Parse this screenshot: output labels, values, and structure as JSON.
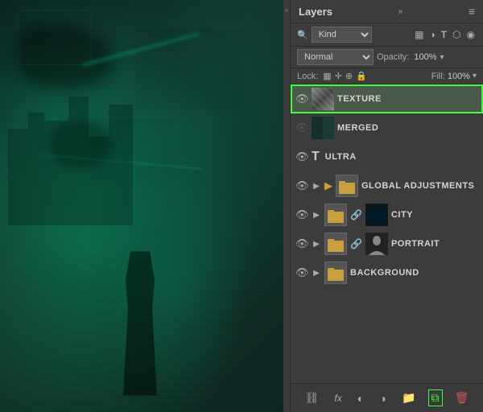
{
  "panel": {
    "title": "Layers",
    "menu_icon": "≡",
    "collapse_icon": "»"
  },
  "filter": {
    "label": "Kind",
    "options": [
      "Kind"
    ],
    "icons": [
      "pixel",
      "adjust",
      "type",
      "shape",
      "smartobj"
    ]
  },
  "blend": {
    "mode": "Normal",
    "opacity_label": "Opacity:",
    "opacity_value": "100%",
    "dropdown_icon": "▾"
  },
  "lock": {
    "label": "Lock:",
    "fill_label": "Fill:",
    "fill_value": "100%"
  },
  "layers": [
    {
      "name": "TEXTURE",
      "visible": true,
      "active": true,
      "type": "pixel",
      "has_expand": false,
      "thumb_type": "texture"
    },
    {
      "name": "MERGED",
      "visible": false,
      "active": false,
      "type": "pixel",
      "has_expand": false,
      "thumb_type": "merged"
    },
    {
      "name": "ULTRA",
      "visible": true,
      "active": false,
      "type": "text",
      "has_expand": false,
      "thumb_type": "none"
    },
    {
      "name": "GLOBAL ADJUSTMENTS",
      "visible": true,
      "active": false,
      "type": "folder",
      "has_expand": true,
      "thumb_type": "folder"
    },
    {
      "name": "CITY",
      "visible": true,
      "active": false,
      "type": "folder",
      "has_expand": true,
      "thumb_type": "city",
      "has_chain": true
    },
    {
      "name": "PORTRAIT",
      "visible": true,
      "active": false,
      "type": "folder",
      "has_expand": true,
      "thumb_type": "portrait",
      "has_chain": true
    },
    {
      "name": "BACKGROUND",
      "visible": true,
      "active": false,
      "type": "folder",
      "has_expand": true,
      "thumb_type": "folder"
    }
  ],
  "toolbar": {
    "link_icon": "🔗",
    "fx_label": "fx",
    "circle_icon": "◐",
    "folder_icon": "📁",
    "new_layer_icon": "⧉",
    "delete_icon": "🗑"
  },
  "colors": {
    "active_green": "#3aff3a",
    "panel_bg": "#3c3c3c",
    "layer_active_bg": "#4a5a4a"
  }
}
